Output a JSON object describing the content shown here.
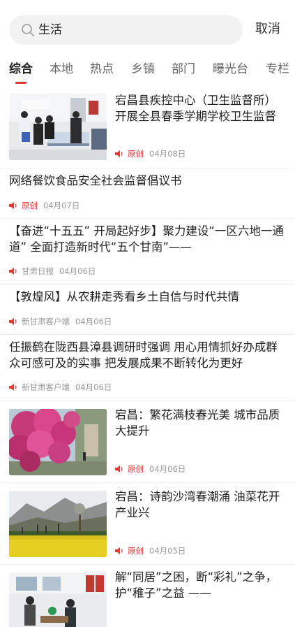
{
  "search": {
    "query": "生活",
    "cancel": "取消"
  },
  "tabs": [
    "综合",
    "本地",
    "热点",
    "乡镇",
    "部门",
    "曝光台",
    "专栏"
  ],
  "news": [
    {
      "title": "宕昌县疾控中心（卫生监督所）开展全县春季学期学校卫生监督检查",
      "source": "原创",
      "date": "04月08日",
      "has_image": true,
      "image": "inspection-photo"
    },
    {
      "title": "网络餐饮食品安全社会监督倡议书",
      "source": "原创",
      "date": "04月07日",
      "has_image": false
    },
    {
      "title": "【奋进“十五五” 开局起好步】聚力建设“一区六地一通道” 全面打造新时代“五个甘南”——",
      "source": "甘肃日报",
      "date": "04月06日",
      "has_image": false
    },
    {
      "title": "【敦煌风】从农耕走秀看乡土自信与时代共情",
      "source": "新甘肃客户端",
      "date": "04月06日",
      "has_image": false
    },
    {
      "title": "任振鹤在陇西县漳县调研时强调 用心用情抓好办成群众可感可及的实事 把发展成果不断转化为更好",
      "source": "新甘肃客户端",
      "date": "04月06日",
      "has_image": false
    },
    {
      "title": "宕昌：繁花满枝春光美 城市品质大提升",
      "source": "原创",
      "date": "04月06日",
      "has_image": true,
      "image": "blossom-photo"
    },
    {
      "title": "宕昌：诗韵沙湾春潮涌 油菜花开产业兴",
      "source": "原创",
      "date": "04月05日",
      "has_image": true,
      "image": "rapeseed-photo"
    },
    {
      "title": "解“同居”之困，断“彩礼”之争，护“稚子”之益 ——",
      "source": "",
      "date": "",
      "has_image": true,
      "image": "office-photo"
    }
  ],
  "colors": {
    "accent": "#e53935",
    "meta": "#999999",
    "title": "#222222"
  }
}
